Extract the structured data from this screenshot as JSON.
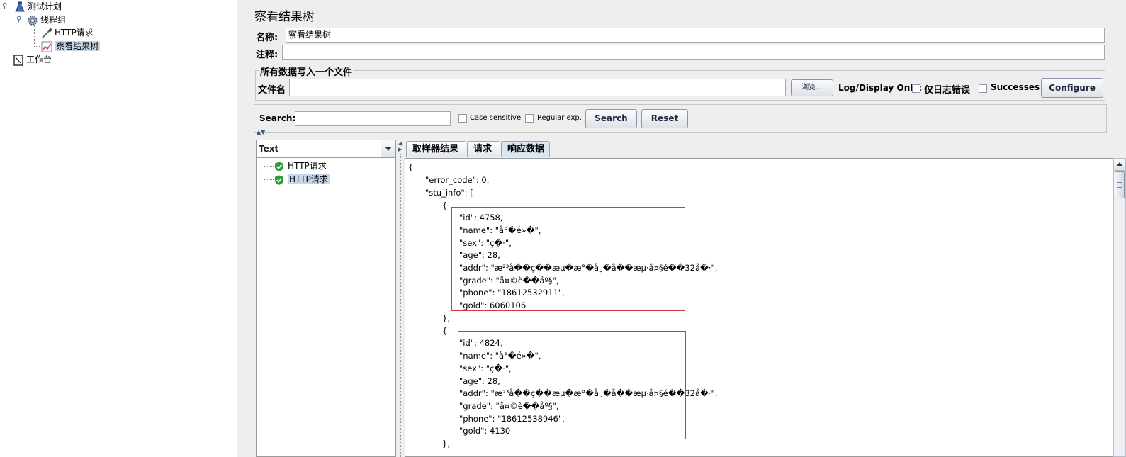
{
  "tree": {
    "test_plan": "测试计划",
    "thread_group": "线程组",
    "http_request": "HTTP请求",
    "result_tree": "察看结果树",
    "workbench": "工作台"
  },
  "panel": {
    "title": "察看结果树",
    "name_label": "名称:",
    "name_value": "察看结果树",
    "comment_label": "注释:",
    "comment_value": ""
  },
  "file_group": {
    "legend": "所有数据写入一个文件",
    "filename_label": "文件名",
    "filename_value": "",
    "browse_label": "浏览...",
    "log_display_label": "Log/Display Only:",
    "errors_only_label": "仅日志错误",
    "successes_label": "Successes",
    "configure_label": "Configure"
  },
  "search": {
    "label": "Search:",
    "value": "",
    "case_sensitive_label": "Case sensitive",
    "regex_label": "Regular exp.",
    "search_button": "Search",
    "reset_button": "Reset"
  },
  "results": {
    "renderer": "Text",
    "samples": [
      "HTTP请求",
      "HTTP请求"
    ]
  },
  "tabs": [
    "取样器结果",
    "请求",
    "响应数据"
  ],
  "active_tab": "响应数据",
  "response": {
    "lines": [
      "{",
      "\"error_code\": 0,",
      "\"stu_info\": [",
      "{",
      "\"id\": 4758,",
      "\"name\": \"å°�é»�\",",
      "\"sex\": \"ç�·\",",
      "\"age\": 28,",
      "\"addr\": \"æ²³å��ç��æµ�æ°�å¸�å��æµ·å¤§é��32å�·\",",
      "\"grade\": \"å¤©è��åº§\",",
      "\"phone\": \"18612532911\",",
      "\"gold\": 6060106",
      "},",
      "{",
      "\"id\": 4824,",
      "\"name\": \"å°�é»�\",",
      "\"sex\": \"ç�·\",",
      "\"age\": 28,",
      "\"addr\": \"æ²³å��ç��æµ�æ°�å¸�å��æµ·å¤§é��32å�·\",",
      "\"grade\": \"å¤©è��åº§\",",
      "\"phone\": \"18612538946\",",
      "\"gold\": 4130",
      "},"
    ]
  },
  "colors": {
    "selection": "#c6d7ec",
    "highlight_box": "#d23b3b",
    "success_icon": "#2e9a3c"
  }
}
